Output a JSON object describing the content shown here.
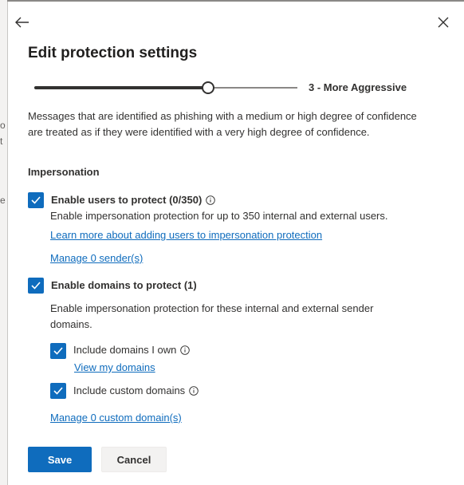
{
  "background": {
    "lines": [
      "o",
      "t",
      "e"
    ]
  },
  "panel": {
    "title": "Edit protection settings",
    "back_icon": "arrow-left-icon",
    "close_icon": "close-icon"
  },
  "slider": {
    "value_label": "3 - More Aggressive",
    "level": 3,
    "max": 4,
    "fill_fraction": 0.66
  },
  "description": "Messages that are identified as phishing with a medium or high degree of confidence are treated as if they were identified with a very high degree of confidence.",
  "impersonation": {
    "heading": "Impersonation",
    "users": {
      "checked": true,
      "label": "Enable users to protect (0/350)",
      "description": "Enable impersonation protection for up to 350 internal and external users.",
      "learn_link": "Learn more about adding users to impersonation protection",
      "manage_link": "Manage 0 sender(s)"
    },
    "domains": {
      "checked": true,
      "label": "Enable domains to protect (1)",
      "description": "Enable impersonation protection for these internal and external sender domains.",
      "include_own": {
        "checked": true,
        "label": "Include domains I own",
        "link": "View my domains"
      },
      "include_custom": {
        "checked": true,
        "label": "Include custom domains"
      },
      "manage_link": "Manage 0 custom domain(s)"
    }
  },
  "footer": {
    "save_label": "Save",
    "cancel_label": "Cancel"
  },
  "colors": {
    "accent": "#0f6cbd",
    "text": "#323130",
    "button_secondary": "#f3f2f1"
  }
}
